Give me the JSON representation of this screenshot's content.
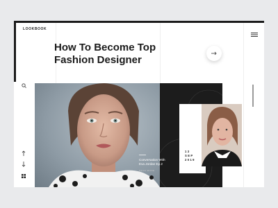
{
  "brand": {
    "name": "LOOKBOOK"
  },
  "headline": {
    "line1": "How To Become Top",
    "line2": "Fashion Designer"
  },
  "feature": {
    "caption_line1": "Conversation With",
    "caption_line2": "Eva Jordan Ep.2",
    "caption_meta": "READ MORE",
    "date_line1": "13",
    "date_line2": "SEP",
    "date_line3": "2019"
  },
  "icons": {
    "menu": "hamburger-icon",
    "search": "search-icon",
    "up": "arrow-up-icon",
    "down": "arrow-down-icon",
    "grid": "grid-icon",
    "next": "arrow-right-icon"
  },
  "colors": {
    "background": "#e9eaec",
    "panel": "#1c1c1c",
    "text": "#1a1a1a"
  }
}
